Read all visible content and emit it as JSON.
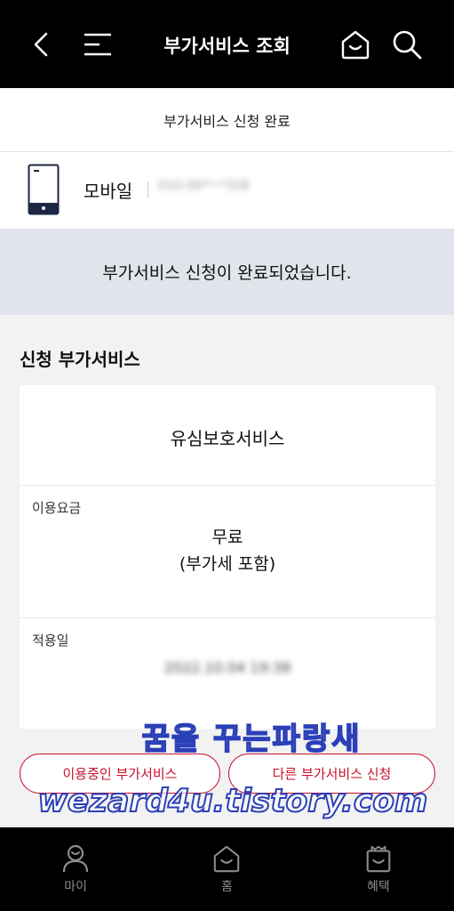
{
  "header": {
    "title": "부가서비스 조회",
    "back_icon": "back-arrow-icon",
    "menu_icon": "menu-icon",
    "home_icon": "home-icon",
    "search_icon": "search-icon"
  },
  "subheader": {
    "title": "부가서비스 신청 완료"
  },
  "device": {
    "label": "모바일",
    "number": "010-56**-*328",
    "icon": "smartphone-icon"
  },
  "notice": {
    "message": "부가서비스 신청이 완료되었습니다."
  },
  "section": {
    "title": "신청 부가서비스"
  },
  "service": {
    "name": "유심보호서비스",
    "fee_label": "이용요금",
    "fee_value": "무료",
    "fee_note": "(부가세 포함)",
    "date_label": "적용일",
    "date_value": "2022.10.04 19:38"
  },
  "buttons": {
    "in_use": "이용중인 부가서비스",
    "other": "다른 부가서비스 신청"
  },
  "watermark": {
    "line1": "꿈을 꾸는파랑새",
    "line2": "wezard4u.tistory.com"
  },
  "bottom_nav": [
    {
      "label": "마이",
      "icon": "person-icon"
    },
    {
      "label": "홈",
      "icon": "home-icon"
    },
    {
      "label": "혜택",
      "icon": "gift-icon"
    }
  ],
  "colors": {
    "accent": "#c8102e",
    "header_bg": "#000000",
    "notice_bg": "#dfe5ea"
  }
}
